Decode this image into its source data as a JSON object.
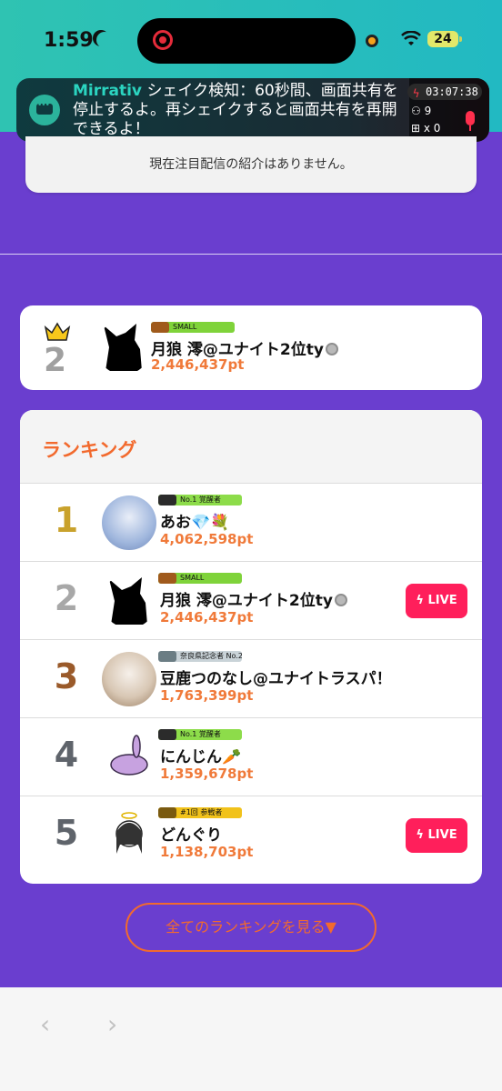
{
  "status_bar": {
    "time": "1:59",
    "battery": "24"
  },
  "notification": {
    "app": "Mirrativ",
    "message": "シェイク検知：60秒間、画面共有を停止するよ。再シェイクすると画面共有を再開できるよ！",
    "rec_time": "03:07:38",
    "viewers": "9",
    "gifts": "x 0"
  },
  "featured": {
    "text": "現在注目配信の紹介はありません。"
  },
  "my_rank": {
    "rank": "2",
    "badge": "SMALL",
    "name": "月狼 澪@ユナイト2位ty",
    "points": "2,446,437pt"
  },
  "ranking": {
    "title": "ランキング",
    "rows": [
      {
        "rank": "1",
        "badge": "No.1 覚醒者",
        "name": "あお💎💐",
        "points": "4,062,598pt",
        "live": false
      },
      {
        "rank": "2",
        "badge": "SMALL",
        "name": "月狼 澪@ユナイト2位ty",
        "points": "2,446,437pt",
        "live": true
      },
      {
        "rank": "3",
        "badge": "奈良県記念者 No.2",
        "name": "豆鹿つのなし@ユナイトラスパ！",
        "points": "1,763,399pt",
        "live": false
      },
      {
        "rank": "4",
        "badge": "No.1 覚醒者",
        "name": "にんじん🥕",
        "points": "1,359,678pt",
        "live": false
      },
      {
        "rank": "5",
        "badge": "#1回 参戦者",
        "name": "どんぐり",
        "points": "1,138,703pt",
        "live": true
      }
    ],
    "live_label": "LIVE"
  },
  "see_all_label": "全てのランキングを見る▼",
  "nav": {
    "back": "‹",
    "forward": "›"
  },
  "colors": {
    "accent": "#f26a2e",
    "live": "#ff1f5b",
    "background": "#6a3ecf",
    "teal": "#2fc3b2"
  }
}
